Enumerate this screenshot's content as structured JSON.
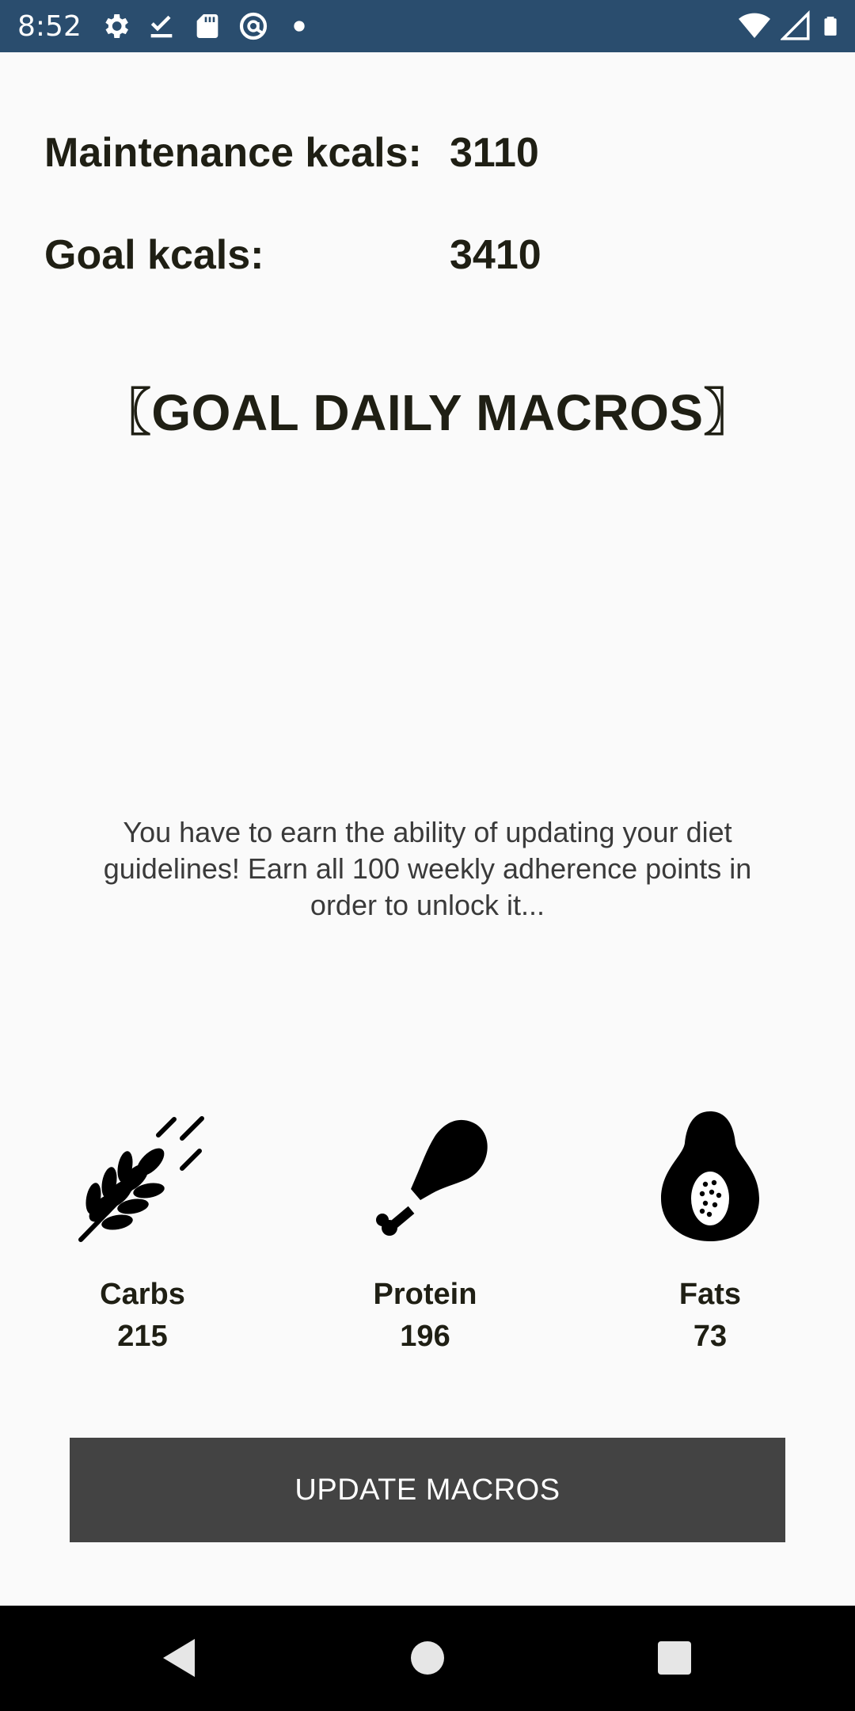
{
  "status_bar": {
    "time": "8:52",
    "left_icons": [
      "gear-icon",
      "check-download-icon",
      "sd-card-icon",
      "circle-a-icon",
      "dot-icon"
    ],
    "right_icons": [
      "wifi-icon",
      "signal-icon",
      "battery-icon"
    ]
  },
  "calories": {
    "maintenance_label": "Maintenance kcals:",
    "maintenance_value": "3110",
    "goal_label": "Goal kcals:",
    "goal_value": "3410"
  },
  "section_title": "〖GOAL DAILY MACROS〗",
  "message": "You have to earn the ability of updating your diet guidelines! Earn all 100 weekly adherence points in order to unlock it...",
  "macros": [
    {
      "name": "Carbs",
      "value": "215",
      "icon": "wheat-icon"
    },
    {
      "name": "Protein",
      "value": "196",
      "icon": "drumstick-icon"
    },
    {
      "name": "Fats",
      "value": "73",
      "icon": "avocado-icon"
    }
  ],
  "update_button_label": "UPDATE MACROS",
  "nav_bar": [
    "back-icon",
    "home-icon",
    "recents-icon"
  ],
  "colors": {
    "status_bar": "#2a4d6e",
    "background": "#fafafa",
    "button": "#434343",
    "text": "#1f1f14"
  }
}
